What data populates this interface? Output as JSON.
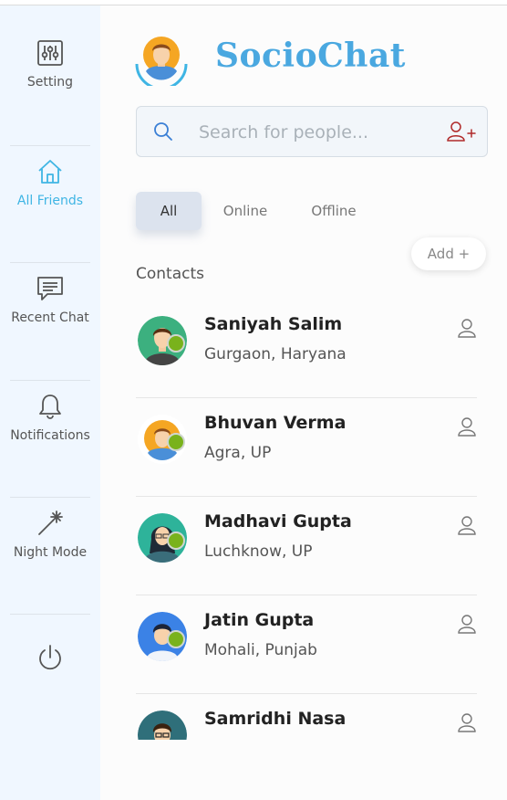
{
  "app": {
    "name": "SocioChat",
    "colors": {
      "accent": "#3fb5e4",
      "brand": "#4aa8e0",
      "online": "#79b21c",
      "sidebar_bg": "#f0f7ff"
    }
  },
  "sidebar": {
    "items": [
      {
        "label": "Setting",
        "icon": "sliders-icon"
      },
      {
        "label": "All Friends",
        "icon": "home-icon",
        "active": true
      },
      {
        "label": "Recent Chat",
        "icon": "chat-icon"
      },
      {
        "label": "Notifications",
        "icon": "bell-icon"
      },
      {
        "label": "Night Mode",
        "icon": "magic-wand-icon"
      },
      {
        "label": "",
        "icon": "power-icon"
      }
    ]
  },
  "search": {
    "placeholder": "Search for people...",
    "value": ""
  },
  "tabs": [
    {
      "label": "All",
      "active": true
    },
    {
      "label": "Online"
    },
    {
      "label": "Offline"
    }
  ],
  "add_button": {
    "label": "Add +"
  },
  "contacts_title": "Contacts",
  "contacts": [
    {
      "name": "Saniyah Salim",
      "location": "Gurgaon, Haryana",
      "online": true
    },
    {
      "name": "Bhuvan Verma",
      "location": "Agra, UP",
      "online": true
    },
    {
      "name": "Madhavi Gupta",
      "location": "Luchknow, UP",
      "online": true
    },
    {
      "name": "Jatin Gupta",
      "location": "Mohali, Punjab",
      "online": true
    },
    {
      "name": "Samridhi Nasa",
      "location": "",
      "online": false
    }
  ]
}
